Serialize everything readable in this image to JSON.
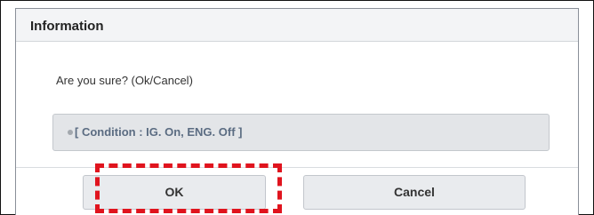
{
  "dialog": {
    "title": "Information",
    "message": "Are you sure? (Ok/Cancel)",
    "condition": "[ Condition : IG. On, ENG. Off ]",
    "buttons": {
      "ok_label": "OK",
      "cancel_label": "Cancel"
    }
  },
  "colors": {
    "highlight": "#e0141e",
    "condition_text": "#5b6c82",
    "button_bg": "#e9ebee",
    "title_bar_bg": "#f3f4f6"
  },
  "icons": {
    "condition_bullet": "bullet-icon"
  }
}
